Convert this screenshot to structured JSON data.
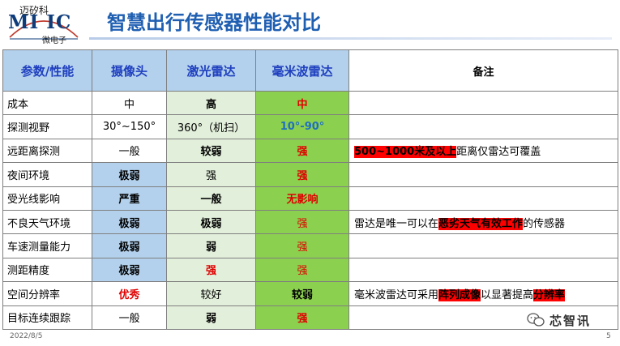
{
  "logo": {
    "top_text": "迈矽科",
    "main_text": "MI IC",
    "bottom_text": "微电子"
  },
  "page": {
    "title": "智慧出行传感器性能对比",
    "date": "2022/8/5",
    "page_number": "5",
    "watermark": "芯智讯"
  },
  "colors": {
    "header_bg": "#b3d1ec",
    "camera_bg": "#b3d1ec",
    "lidar_bg": "#e2efda",
    "radar_bg": "#8cd04f",
    "highlight": "#ff0000",
    "title_blue": "#1f5fb2"
  },
  "table": {
    "headers": [
      "参数/性能",
      "摄像头",
      "激光雷达",
      "毫米波雷达",
      "备注"
    ],
    "rows": [
      {
        "param": "成本",
        "camera": "中",
        "lidar": "高",
        "radar": "中",
        "note": []
      },
      {
        "param": "探测视野",
        "camera": "30°~150°",
        "lidar": "360°（机扫）",
        "radar": "10°-90°",
        "note": []
      },
      {
        "param": "远距离探测",
        "camera": "一般",
        "lidar": "较弱",
        "radar": "强",
        "note": [
          {
            "text": "500~1000米及以上",
            "hl": true
          },
          {
            "text": "距离仅雷达可覆盖",
            "hl": false
          }
        ]
      },
      {
        "param": "夜间环境",
        "camera": "极弱",
        "lidar": "强",
        "radar": "强",
        "note": []
      },
      {
        "param": "受光线影响",
        "camera": "严重",
        "lidar": "一般",
        "radar": "无影响",
        "note": []
      },
      {
        "param": "不良天气环境",
        "camera": "极弱",
        "lidar": "极弱",
        "radar": "强",
        "note": [
          {
            "text": "雷达是唯一可以在",
            "hl": false
          },
          {
            "text": "恶劣天气有效工作",
            "hl": true
          },
          {
            "text": "的传感器",
            "hl": false
          }
        ]
      },
      {
        "param": "车速测量能力",
        "camera": "极弱",
        "lidar": "弱",
        "radar": "强",
        "note": []
      },
      {
        "param": "测距精度",
        "camera": "极弱",
        "lidar": "强",
        "radar": "强",
        "note": []
      },
      {
        "param": "空间分辨率",
        "camera": "优秀",
        "lidar": "较好",
        "radar": "较弱",
        "note": [
          {
            "text": "毫米波雷达可采用",
            "hl": false
          },
          {
            "text": "阵列成像",
            "hl": true
          },
          {
            "text": "以显著提高",
            "hl": false
          },
          {
            "text": "分辨率",
            "hl": true
          }
        ]
      },
      {
        "param": "目标连续跟踪",
        "camera": "一般",
        "lidar": "弱",
        "radar": "强",
        "note": []
      }
    ]
  }
}
